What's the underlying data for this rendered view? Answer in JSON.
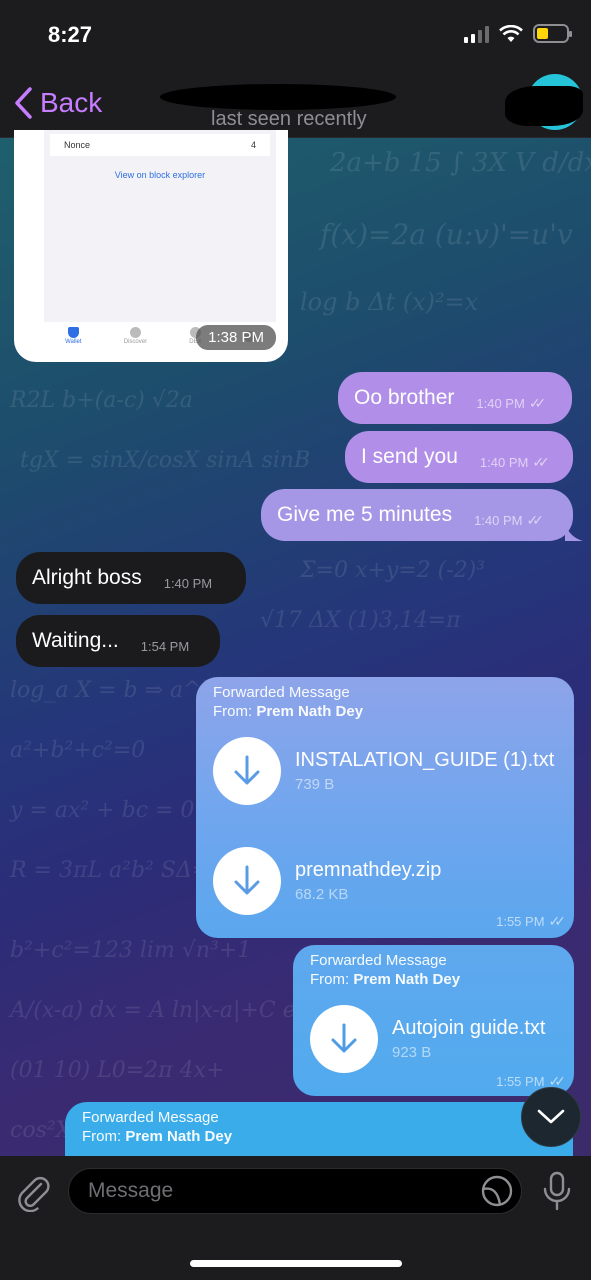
{
  "status_bar": {
    "time": "8:27"
  },
  "header": {
    "back_label": "Back",
    "subtitle": "last seen recently"
  },
  "shared_screenshot": {
    "nonce_label": "Nonce",
    "nonce_value": "4",
    "explorer_link": "View on block explorer",
    "tabs": [
      "Wallet",
      "Discover",
      "DEX",
      ""
    ],
    "time": "1:38 PM"
  },
  "messages": [
    {
      "text": "Oo brother",
      "time": "1:40 PM",
      "direction": "out"
    },
    {
      "text": "I send you",
      "time": "1:40 PM",
      "direction": "out"
    },
    {
      "text": "Give me 5 minutes",
      "time": "1:40 PM",
      "direction": "out"
    },
    {
      "text": "Alright boss",
      "time": "1:40 PM",
      "direction": "in"
    },
    {
      "text": "Waiting...",
      "time": "1:54 PM",
      "direction": "in"
    }
  ],
  "forwarded_1": {
    "title": "Forwarded Message",
    "from_prefix": "From:",
    "from_name": "Prem Nath Dey",
    "files": [
      {
        "name": "INSTALATION_GUIDE (1).txt",
        "size": "739 B"
      },
      {
        "name": "premnathdey.zip",
        "size": "68.2 KB"
      }
    ],
    "time": "1:55 PM"
  },
  "forwarded_2": {
    "title": "Forwarded Message",
    "from_prefix": "From:",
    "from_name": "Prem Nath Dey",
    "files": [
      {
        "name": "Autojoin guide.txt",
        "size": "923 B"
      }
    ],
    "time": "1:55 PM"
  },
  "forwarded_3": {
    "title": "Forwarded Message",
    "from_prefix": "From:",
    "from_name": "Prem Nath Dey"
  },
  "input": {
    "placeholder": "Message"
  },
  "colors": {
    "accent": "#c77dff",
    "outgoing_bubble": "#b18ee8",
    "incoming_bubble": "#1b1b1d",
    "file_bubble_blue": "#5aa7ee"
  },
  "icons": [
    "back-chevron-icon",
    "attach-paperclip-icon",
    "sticker-icon",
    "microphone-icon",
    "download-arrow-icon",
    "chevron-down-icon",
    "double-check-icon"
  ]
}
